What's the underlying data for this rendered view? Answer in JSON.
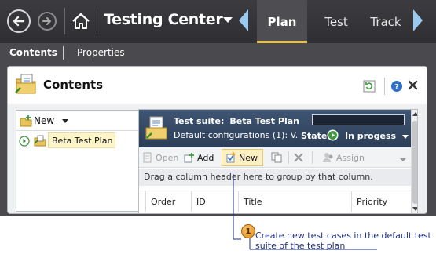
{
  "app": {
    "title": "Testing Center",
    "tabs": [
      {
        "label": "Plan",
        "active": true
      },
      {
        "label": "Test",
        "active": false
      },
      {
        "label": "Track",
        "active": false
      }
    ]
  },
  "subnav": {
    "contents": "Contents",
    "properties": "Properties"
  },
  "panel": {
    "title": "Contents"
  },
  "tree": {
    "new_label": "New",
    "root_item": "Beta Test Plan"
  },
  "suite": {
    "label_prefix": "Test suite:",
    "name": "Beta Test Plan",
    "config": "Default configurations (1): V.",
    "state_label": "State:",
    "state_value": "In progess"
  },
  "toolbar": {
    "open": "Open",
    "add": "Add",
    "new": "New",
    "assign": "Assign"
  },
  "grid": {
    "group_hint": "Drag a column header here to group by that column.",
    "columns": [
      "Order",
      "ID",
      "Title",
      "Priority"
    ]
  },
  "callout": {
    "number": "1",
    "text": "Create new test cases in the default test suite of the test plan"
  },
  "colors": {
    "chrome": "#3b3b40",
    "accent_tab_underline": "#e6c24a",
    "nav_arrows": "#9bc8ee",
    "suite_header": "#3f5573",
    "callout_text": "#1f2e78",
    "callout_badge": "#e08a1b"
  }
}
